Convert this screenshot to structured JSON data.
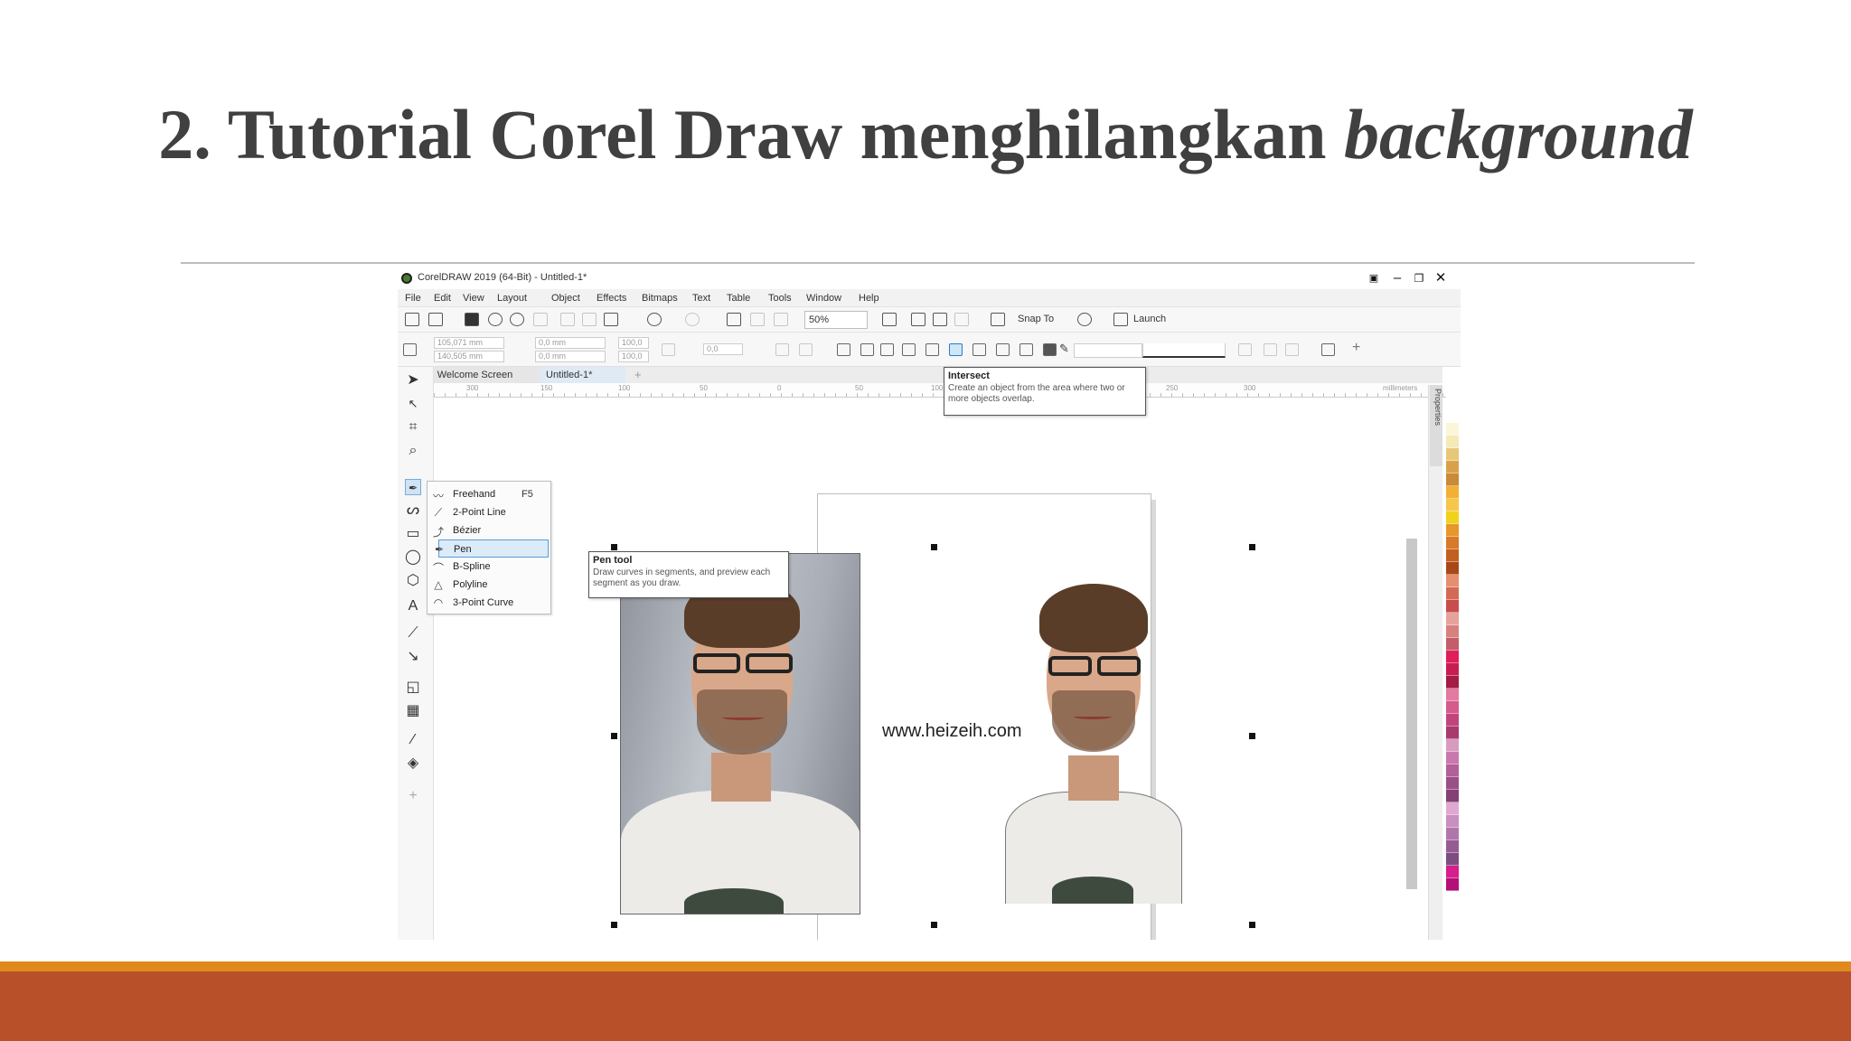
{
  "slide": {
    "title_plain": "2. Tutorial Corel Draw menghilangkan ",
    "title_italic": "background"
  },
  "window": {
    "title": "CorelDRAW 2019 (64-Bit) - Untitled-1*"
  },
  "menu": [
    "File",
    "Edit",
    "View",
    "Layout",
    "Object",
    "Effects",
    "Bitmaps",
    "Text",
    "Table",
    "Tools",
    "Window",
    "Help"
  ],
  "toolbar": {
    "zoom": "50%",
    "snap_label": "Snap To",
    "launch_label": "Launch"
  },
  "property_bar": {
    "x": "105,071 mm",
    "y": "140,505 mm",
    "w": "0,0 mm",
    "h": "0,0 mm",
    "sx": "100,0",
    "sy": "100,0",
    "angle": "0,0"
  },
  "tabs": {
    "welcome": "Welcome Screen",
    "doc": "Untitled-1*"
  },
  "ruler_labels": [
    "300",
    "150",
    "100",
    "50",
    "0",
    "50",
    "100",
    "150",
    "200",
    "250",
    "300",
    "millimeters"
  ],
  "flyout_items": [
    {
      "label": "Freehand",
      "shortcut": "F5"
    },
    {
      "label": "2-Point Line",
      "shortcut": ""
    },
    {
      "label": "Bézier",
      "shortcut": ""
    },
    {
      "label": "Pen",
      "shortcut": ""
    },
    {
      "label": "B-Spline",
      "shortcut": ""
    },
    {
      "label": "Polyline",
      "shortcut": ""
    },
    {
      "label": "3-Point Curve",
      "shortcut": ""
    }
  ],
  "tooltips": {
    "pen": {
      "title": "Pen tool",
      "desc": "Draw curves in segments, and preview each segment as you draw."
    },
    "intersect": {
      "title": "Intersect",
      "desc": "Create an object from the area where two or more objects overlap."
    }
  },
  "canvas": {
    "watermark": "www.heizeih.com"
  },
  "docker": {
    "tab_label": "Properties"
  },
  "palette_colors": [
    "#fbf6d8",
    "#f6e9b8",
    "#e8c77a",
    "#d9a24a",
    "#c98a3a",
    "#f2b134",
    "#f7c64a",
    "#f0d21d",
    "#e7962b",
    "#d77a2a",
    "#c2611f",
    "#a8481a",
    "#e58f6e",
    "#d46a55",
    "#c84d4d",
    "#e6a29c",
    "#d7817f",
    "#c45c6a",
    "#e01e5a",
    "#c81d4f",
    "#a31c44",
    "#e37aa0",
    "#d65a8c",
    "#c0457c",
    "#a83a6d",
    "#d99ac0",
    "#c779ad",
    "#b35f9a",
    "#9b4f88",
    "#834273",
    "#e0a8d0",
    "#c98fbf",
    "#b075aa",
    "#955c94",
    "#7d4d80",
    "#d61e8c",
    "#b31078"
  ],
  "colors": {
    "title": "#404040",
    "accent_thin": "#e08a1e",
    "accent_thick": "#b8512a"
  }
}
